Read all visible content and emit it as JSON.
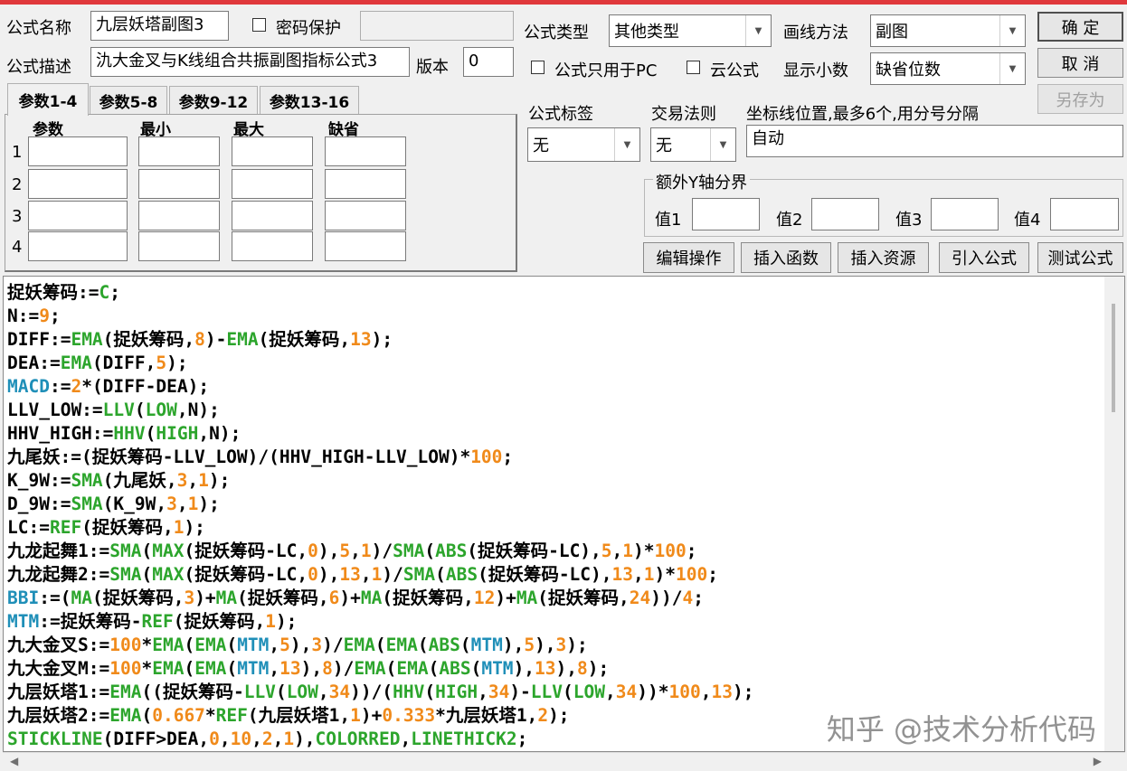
{
  "colors": {
    "accent_bar": "#e0383c",
    "keyword": "#1f8fb8",
    "function": "#2ca52c",
    "number": "#f08a1a",
    "text": "#000000"
  },
  "form": {
    "name_label": "公式名称",
    "name_value": "九层妖塔副图3",
    "password_label": "密码保护",
    "desc_label": "公式描述",
    "desc_value": "氿大金叉与K线组合共振副图指标公式3",
    "version_label": "版本",
    "version_value": "0",
    "type_label": "公式类型",
    "type_value": "其他类型",
    "draw_label": "画线方法",
    "draw_value": "副图",
    "pc_only_label": "公式只用于PC",
    "cloud_label": "云公式",
    "decimals_label": "显示小数",
    "decimals_value": "缺省位数",
    "tag_label": "公式标签",
    "tag_value": "无",
    "rule_label": "交易法则",
    "rule_value": "无",
    "coord_label": "坐标线位置,最多6个,用分号分隔",
    "coord_value": "自动",
    "extra_y_label": "额外Y轴分界",
    "val1": "值1",
    "val2": "值2",
    "val3": "值3",
    "val4": "值4"
  },
  "buttons": {
    "ok": "确  定",
    "cancel": "取  消",
    "save_as": "另存为",
    "edit": "编辑操作",
    "insert_func": "插入函数",
    "insert_res": "插入资源",
    "import": "引入公式",
    "test": "测试公式"
  },
  "tabs": [
    "参数1-4",
    "参数5-8",
    "参数9-12",
    "参数13-16"
  ],
  "params": {
    "headers": [
      "参数",
      "最小",
      "最大",
      "缺省"
    ],
    "rows": [
      "1",
      "2",
      "3",
      "4"
    ]
  },
  "code": [
    [
      [
        "捉妖筹码:=",
        ""
      ],
      [
        "C",
        "f"
      ],
      [
        ";",
        ""
      ]
    ],
    [
      [
        "N:=",
        ""
      ],
      [
        "9",
        "n"
      ],
      [
        ";",
        ""
      ]
    ],
    [
      [
        "DIFF:=",
        ""
      ],
      [
        "EMA",
        "f"
      ],
      [
        "(捉妖筹码,",
        ""
      ],
      [
        "8",
        "n"
      ],
      [
        ")-",
        ""
      ],
      [
        "EMA",
        "f"
      ],
      [
        "(捉妖筹码,",
        ""
      ],
      [
        "13",
        "n"
      ],
      [
        ");",
        ""
      ]
    ],
    [
      [
        "DEA:=",
        ""
      ],
      [
        "EMA",
        "f"
      ],
      [
        "(DIFF,",
        ""
      ],
      [
        "5",
        "n"
      ],
      [
        ");",
        ""
      ]
    ],
    [
      [
        "MACD",
        "k"
      ],
      [
        ":=",
        ""
      ],
      [
        "2",
        "n"
      ],
      [
        "*(DIFF-DEA);",
        ""
      ]
    ],
    [
      [
        "LLV_LOW:=",
        ""
      ],
      [
        "LLV",
        "f"
      ],
      [
        "(",
        ""
      ],
      [
        "LOW",
        "f"
      ],
      [
        ",N);",
        ""
      ]
    ],
    [
      [
        "HHV_HIGH:=",
        ""
      ],
      [
        "HHV",
        "f"
      ],
      [
        "(",
        ""
      ],
      [
        "HIGH",
        "f"
      ],
      [
        ",N);",
        ""
      ]
    ],
    [
      [
        "九尾妖:=(捉妖筹码-LLV_LOW)/(HHV_HIGH-LLV_LOW)*",
        ""
      ],
      [
        "100",
        "n"
      ],
      [
        ";",
        ""
      ]
    ],
    [
      [
        "K_9W:=",
        ""
      ],
      [
        "SMA",
        "f"
      ],
      [
        "(九尾妖,",
        ""
      ],
      [
        "3",
        "n"
      ],
      [
        ",",
        ""
      ],
      [
        "1",
        "n"
      ],
      [
        ");",
        ""
      ]
    ],
    [
      [
        "D_9W:=",
        ""
      ],
      [
        "SMA",
        "f"
      ],
      [
        "(K_9W,",
        ""
      ],
      [
        "3",
        "n"
      ],
      [
        ",",
        ""
      ],
      [
        "1",
        "n"
      ],
      [
        ");",
        ""
      ]
    ],
    [
      [
        "LC:=",
        ""
      ],
      [
        "REF",
        "f"
      ],
      [
        "(捉妖筹码,",
        ""
      ],
      [
        "1",
        "n"
      ],
      [
        ");",
        ""
      ]
    ],
    [
      [
        "九龙起舞1:=",
        ""
      ],
      [
        "SMA",
        "f"
      ],
      [
        "(",
        ""
      ],
      [
        "MAX",
        "f"
      ],
      [
        "(捉妖筹码-LC,",
        ""
      ],
      [
        "0",
        "n"
      ],
      [
        "),",
        ""
      ],
      [
        "5",
        "n"
      ],
      [
        ",",
        ""
      ],
      [
        "1",
        "n"
      ],
      [
        ")/",
        ""
      ],
      [
        "SMA",
        "f"
      ],
      [
        "(",
        ""
      ],
      [
        "ABS",
        "f"
      ],
      [
        "(捉妖筹码-LC),",
        ""
      ],
      [
        "5",
        "n"
      ],
      [
        ",",
        ""
      ],
      [
        "1",
        "n"
      ],
      [
        ")*",
        ""
      ],
      [
        "100",
        "n"
      ],
      [
        ";",
        ""
      ]
    ],
    [
      [
        "九龙起舞2:=",
        ""
      ],
      [
        "SMA",
        "f"
      ],
      [
        "(",
        ""
      ],
      [
        "MAX",
        "f"
      ],
      [
        "(捉妖筹码-LC,",
        ""
      ],
      [
        "0",
        "n"
      ],
      [
        "),",
        ""
      ],
      [
        "13",
        "n"
      ],
      [
        ",",
        ""
      ],
      [
        "1",
        "n"
      ],
      [
        ")/",
        ""
      ],
      [
        "SMA",
        "f"
      ],
      [
        "(",
        ""
      ],
      [
        "ABS",
        "f"
      ],
      [
        "(捉妖筹码-LC),",
        ""
      ],
      [
        "13",
        "n"
      ],
      [
        ",",
        ""
      ],
      [
        "1",
        "n"
      ],
      [
        ")*",
        ""
      ],
      [
        "100",
        "n"
      ],
      [
        ";",
        ""
      ]
    ],
    [
      [
        "BBI",
        "k"
      ],
      [
        ":=(",
        ""
      ],
      [
        "MA",
        "f"
      ],
      [
        "(捉妖筹码,",
        ""
      ],
      [
        "3",
        "n"
      ],
      [
        ")+",
        ""
      ],
      [
        "MA",
        "f"
      ],
      [
        "(捉妖筹码,",
        ""
      ],
      [
        "6",
        "n"
      ],
      [
        ")+",
        ""
      ],
      [
        "MA",
        "f"
      ],
      [
        "(捉妖筹码,",
        ""
      ],
      [
        "12",
        "n"
      ],
      [
        ")+",
        ""
      ],
      [
        "MA",
        "f"
      ],
      [
        "(捉妖筹码,",
        ""
      ],
      [
        "24",
        "n"
      ],
      [
        "))/",
        ""
      ],
      [
        "4",
        "n"
      ],
      [
        ";",
        ""
      ]
    ],
    [
      [
        "MTM",
        "k"
      ],
      [
        ":=捉妖筹码-",
        ""
      ],
      [
        "REF",
        "f"
      ],
      [
        "(捉妖筹码,",
        ""
      ],
      [
        "1",
        "n"
      ],
      [
        ");",
        ""
      ]
    ],
    [
      [
        "九大金叉S:=",
        ""
      ],
      [
        "100",
        "n"
      ],
      [
        "*",
        ""
      ],
      [
        "EMA",
        "f"
      ],
      [
        "(",
        ""
      ],
      [
        "EMA",
        "f"
      ],
      [
        "(",
        ""
      ],
      [
        "MTM",
        "k"
      ],
      [
        ",",
        ""
      ],
      [
        "5",
        "n"
      ],
      [
        "),",
        ""
      ],
      [
        "3",
        "n"
      ],
      [
        ")/",
        ""
      ],
      [
        "EMA",
        "f"
      ],
      [
        "(",
        ""
      ],
      [
        "EMA",
        "f"
      ],
      [
        "(",
        ""
      ],
      [
        "ABS",
        "f"
      ],
      [
        "(",
        ""
      ],
      [
        "MTM",
        "k"
      ],
      [
        "),",
        ""
      ],
      [
        "5",
        "n"
      ],
      [
        "),",
        ""
      ],
      [
        "3",
        "n"
      ],
      [
        ");",
        ""
      ]
    ],
    [
      [
        "九大金叉M:=",
        ""
      ],
      [
        "100",
        "n"
      ],
      [
        "*",
        ""
      ],
      [
        "EMA",
        "f"
      ],
      [
        "(",
        ""
      ],
      [
        "EMA",
        "f"
      ],
      [
        "(",
        ""
      ],
      [
        "MTM",
        "k"
      ],
      [
        ",",
        ""
      ],
      [
        "13",
        "n"
      ],
      [
        "),",
        ""
      ],
      [
        "8",
        "n"
      ],
      [
        ")/",
        ""
      ],
      [
        "EMA",
        "f"
      ],
      [
        "(",
        ""
      ],
      [
        "EMA",
        "f"
      ],
      [
        "(",
        ""
      ],
      [
        "ABS",
        "f"
      ],
      [
        "(",
        ""
      ],
      [
        "MTM",
        "k"
      ],
      [
        "),",
        ""
      ],
      [
        "13",
        "n"
      ],
      [
        "),",
        ""
      ],
      [
        "8",
        "n"
      ],
      [
        ");",
        ""
      ]
    ],
    [
      [
        "九层妖塔1:=",
        ""
      ],
      [
        "EMA",
        "f"
      ],
      [
        "((捉妖筹码-",
        ""
      ],
      [
        "LLV",
        "f"
      ],
      [
        "(",
        ""
      ],
      [
        "LOW",
        "f"
      ],
      [
        ",",
        ""
      ],
      [
        "34",
        "n"
      ],
      [
        "))/(",
        ""
      ],
      [
        "HHV",
        "f"
      ],
      [
        "(",
        ""
      ],
      [
        "HIGH",
        "f"
      ],
      [
        ",",
        ""
      ],
      [
        "34",
        "n"
      ],
      [
        ")-",
        ""
      ],
      [
        "LLV",
        "f"
      ],
      [
        "(",
        ""
      ],
      [
        "LOW",
        "f"
      ],
      [
        ",",
        ""
      ],
      [
        "34",
        "n"
      ],
      [
        "))*",
        ""
      ],
      [
        "100",
        "n"
      ],
      [
        ",",
        ""
      ],
      [
        "13",
        "n"
      ],
      [
        ");",
        ""
      ]
    ],
    [
      [
        "九层妖塔2:=",
        ""
      ],
      [
        "EMA",
        "f"
      ],
      [
        "(",
        ""
      ],
      [
        "0.667",
        "n"
      ],
      [
        "*",
        ""
      ],
      [
        "REF",
        "f"
      ],
      [
        "(九层妖塔1,",
        ""
      ],
      [
        "1",
        "n"
      ],
      [
        ")+",
        ""
      ],
      [
        "0.333",
        "n"
      ],
      [
        "*九层妖塔1,",
        ""
      ],
      [
        "2",
        "n"
      ],
      [
        ");",
        ""
      ]
    ],
    [
      [
        "STICKLINE",
        "f"
      ],
      [
        "(DIFF>DEA,",
        ""
      ],
      [
        "0",
        "n"
      ],
      [
        ",",
        ""
      ],
      [
        "10",
        "n"
      ],
      [
        ",",
        ""
      ],
      [
        "2",
        "n"
      ],
      [
        ",",
        ""
      ],
      [
        "1",
        "n"
      ],
      [
        "),",
        ""
      ],
      [
        "COLORRED",
        "f"
      ],
      [
        ",",
        ""
      ],
      [
        "LINETHICK2",
        "f"
      ],
      [
        ";",
        ""
      ]
    ]
  ],
  "watermark": "知乎 @技术分析代码"
}
